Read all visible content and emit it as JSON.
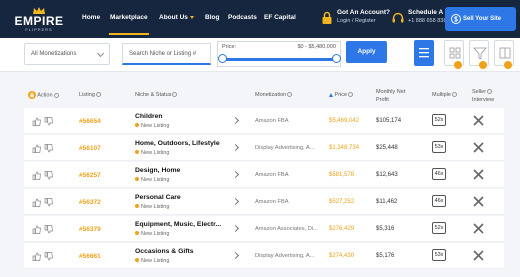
{
  "nav": {
    "brand": "EMPIRE",
    "brand_sub": "FLIPPERS",
    "items": [
      {
        "label": "Home"
      },
      {
        "label": "Marketplace"
      },
      {
        "label": "About Us"
      },
      {
        "label": "Blog"
      },
      {
        "label": "Podcasts"
      },
      {
        "label": "EF Capital"
      }
    ],
    "account_title": "Got An Account?",
    "account_sub": "Login / Register",
    "call_title": "Schedule A Call",
    "call_phone": "+1 888 658 8388",
    "sell_label": "Sell Your Site",
    "accent": "#f0b51f",
    "bg": "#16263f"
  },
  "filters": {
    "monetization_value": "All Monetizations",
    "search_placeholder": "Search Niche or Listing #",
    "price_label": "Price:",
    "price_range": "$0 - $5,480,000",
    "price_fill": 1.0,
    "apply_label": "Apply",
    "accent": "#2d78e6"
  },
  "table": {
    "headers": {
      "action": "Action",
      "listing": "Listing",
      "niche": "Niche & Status",
      "monetization": "Monetization",
      "price": "Price",
      "net_profit_1": "Monthly Net",
      "net_profit_2": "Profit",
      "multiple": "Multiple",
      "seller_1": "Seller",
      "seller_2": "Interview"
    },
    "rows": [
      {
        "id": "#56654",
        "niche": "Children",
        "status": "New Listing",
        "monetization": "Amazon FBA",
        "price": "$5,469,042",
        "net": "$105,174",
        "multiple": "52x"
      },
      {
        "id": "#56107",
        "niche": "Home, Outdoors, Lifestyle",
        "status": "New Listing",
        "monetization": "Display Advertising, A...",
        "price": "$1,348,734",
        "net": "$25,448",
        "multiple": "53x"
      },
      {
        "id": "#56257",
        "niche": "Design, Home",
        "status": "New Listing",
        "monetization": "Amazon FBA",
        "price": "$581,578",
        "net": "$12,643",
        "multiple": "46x"
      },
      {
        "id": "#56372",
        "niche": "Personal Care",
        "status": "New Listing",
        "monetization": "Amazon FBA",
        "price": "$527,252",
        "net": "$11,462",
        "multiple": "46x"
      },
      {
        "id": "#56379",
        "niche": "Equipment, Music, Electr...",
        "status": "New Listing",
        "monetization": "Amazon Associates, Di...",
        "price": "$276,429",
        "net": "$5,316",
        "multiple": "52x"
      },
      {
        "id": "#56661",
        "niche": "Occasions & Gifts",
        "status": "New Listing",
        "monetization": "Display Advertising, A...",
        "price": "$274,430",
        "net": "$5,176",
        "multiple": "53x"
      }
    ]
  }
}
